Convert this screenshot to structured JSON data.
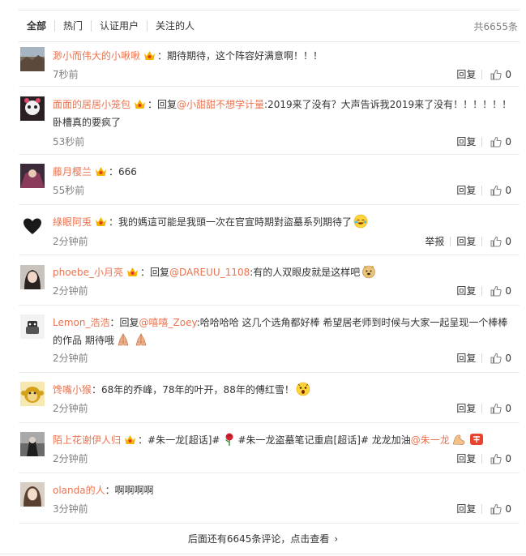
{
  "tabs": [
    "全部",
    "热门",
    "认证用户",
    "关注的人"
  ],
  "total": "共6655条",
  "actions": {
    "reply": "回复",
    "report": "举报",
    "zero": "0"
  },
  "colors": {
    "username": "#eb7350",
    "link": "#eb7350",
    "muted": "#808080"
  },
  "comments": [
    {
      "user": "渺小而伟大的小啾啾",
      "text": "：期待期待，这个阵容好满意啊！！！",
      "time": "7秒前"
    },
    {
      "user": "面面的居居小笼包",
      "reply_prefix": "：回复",
      "mention": "@小甜甜不想学计量",
      "text": ":2019来了没有？大声告诉我2019来了没有！！！！！！卧槽真的要疯了",
      "time": "53秒前"
    },
    {
      "user": "藤月樱兰",
      "text": "：666",
      "time": "55秒前"
    },
    {
      "user": "綠眼阿兎",
      "text": "：我的媽這可能是我頭一次在官宣時期對盜墓系列期待了",
      "emoji": "laugh-cry-emoji",
      "time": "2分钟前",
      "report": true
    },
    {
      "user": "phoebe_小月亮",
      "reply_prefix": "：回复",
      "mention": "@DAREUU_1108",
      "text": ":有的人双眼皮就是这样吧",
      "emoji": "doge-emoji",
      "time": "2分钟前"
    },
    {
      "user": "Lemon_浩浩",
      "reply_prefix": "：回复",
      "mention": "@嘻嘻_Zoey",
      "text": ":哈哈哈哈 这几个选角都好棒 希望居老师到时候与大家一起呈现一个棒棒的作品 期待哦",
      "emoji": "pray-emoji",
      "time": "2分钟前"
    },
    {
      "user": "馋嘴小猴",
      "text": "：68年的乔峰，78年的叶开，88年的傅红雪！",
      "emoji": "shocked-emoji",
      "time": "2分钟前"
    },
    {
      "user": "陌上花谢伊人归",
      "text1": "：#朱一龙[超话]#",
      "text2": "#朱一龙盗墓笔记重启[超话]# 龙龙加油",
      "mention": "@朱一龙",
      "time": "2分钟前"
    },
    {
      "user": "olanda的人",
      "text": "：啊啊啊啊",
      "time": "3分钟前"
    }
  ],
  "more_text": "后面还有6645条评论，点击查看"
}
